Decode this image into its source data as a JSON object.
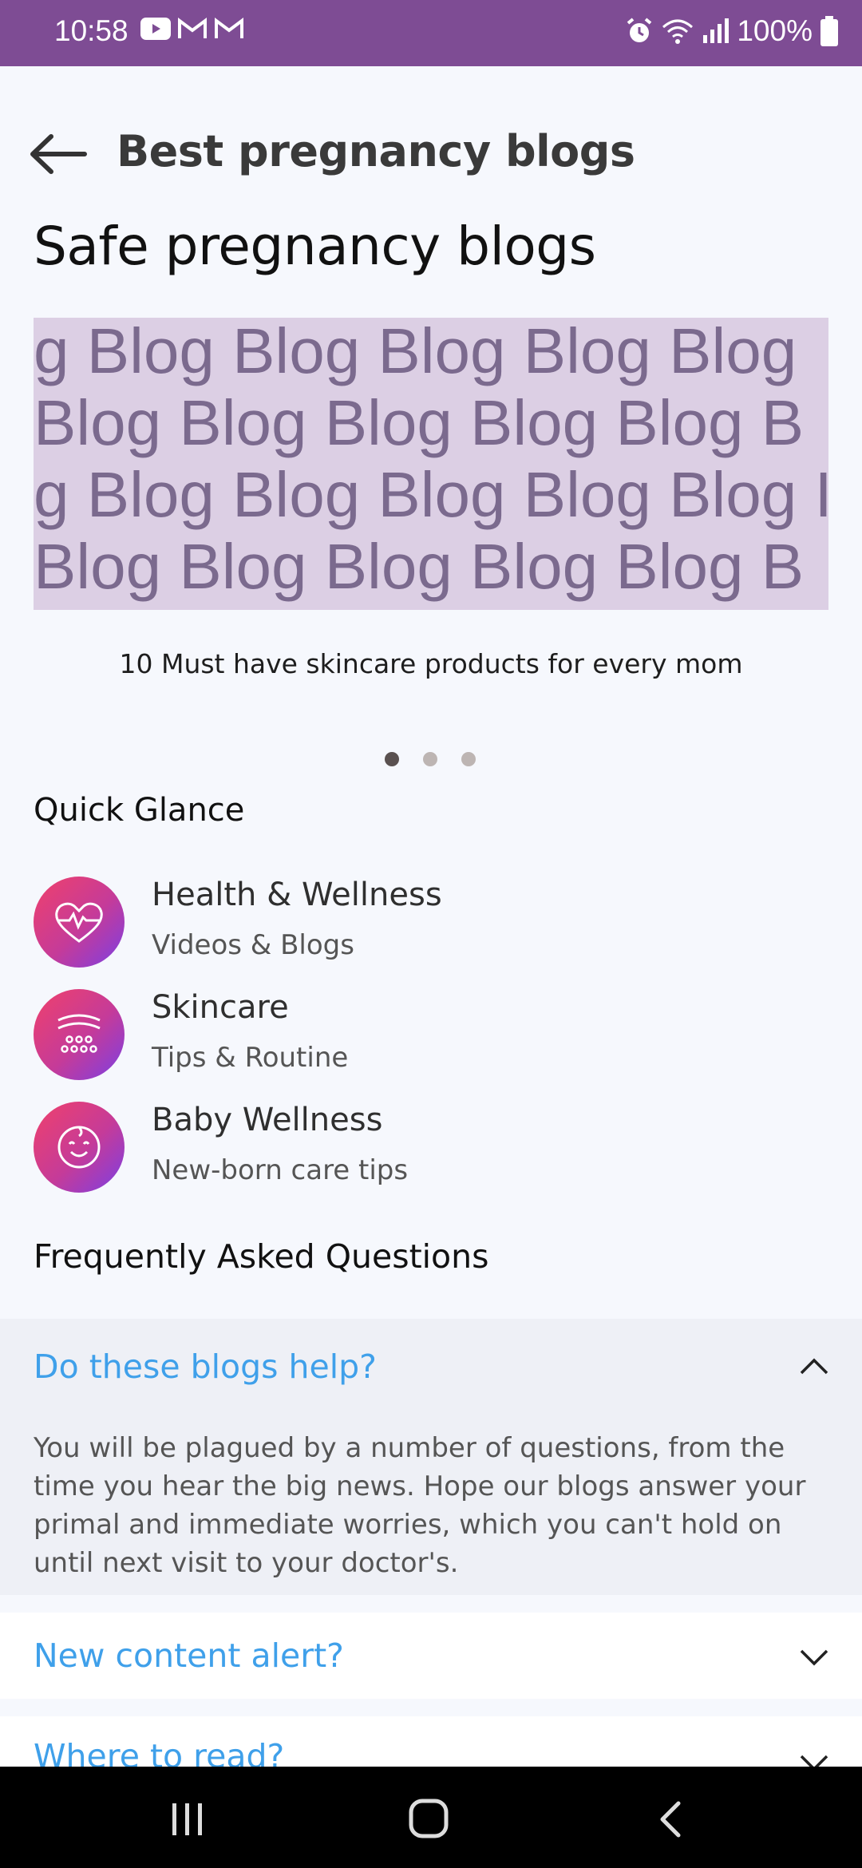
{
  "status_bar": {
    "time": "10:58",
    "battery": "100%",
    "notification_icons": [
      "youtube-icon",
      "gmail-icon",
      "gmail-icon"
    ],
    "system_icons": [
      "alarm-icon",
      "wifi-icon",
      "signal-icon",
      "battery-icon"
    ]
  },
  "header": {
    "title": "Best pregnancy blogs"
  },
  "section": {
    "title": "Safe pregnancy blogs"
  },
  "carousel": {
    "banner_rows": [
      "g Blog Blog Blog Blog Blog",
      " Blog Blog Blog Blog Blog B",
      "g Blog Blog Blog Blog Blog I",
      " Blog Blog Blog Blog Blog B"
    ],
    "caption": "10 Must have skincare products for every mom",
    "page_count": 3,
    "active_index": 0
  },
  "quick_glance": {
    "title": "Quick Glance",
    "items": [
      {
        "name": "Health & Wellness",
        "sub": "Videos & Blogs",
        "icon": "heart-pulse-icon"
      },
      {
        "name": "Skincare",
        "sub": "Tips & Routine",
        "icon": "skin-layers-icon"
      },
      {
        "name": "Baby Wellness",
        "sub": "New-born care tips",
        "icon": "baby-face-icon"
      }
    ]
  },
  "faq": {
    "title": "Frequently Asked Questions",
    "items": [
      {
        "question": "Do these blogs help?",
        "answer": "You will be plagued by a number of questions, from the time you hear the big news. Hope our blogs answer your primal and immediate worries, which you can't hold on until next visit to your doctor's.",
        "expanded": true
      },
      {
        "question": "New content alert?",
        "expanded": false
      },
      {
        "question": "Where to read?",
        "expanded": false
      }
    ]
  },
  "colors": {
    "status_bar": "#7e4c94",
    "accent_link": "#3fa0ea",
    "icon_gradient_start": "#f0416b",
    "icon_gradient_end": "#7b3fe4",
    "background": "#f6f8fd"
  }
}
